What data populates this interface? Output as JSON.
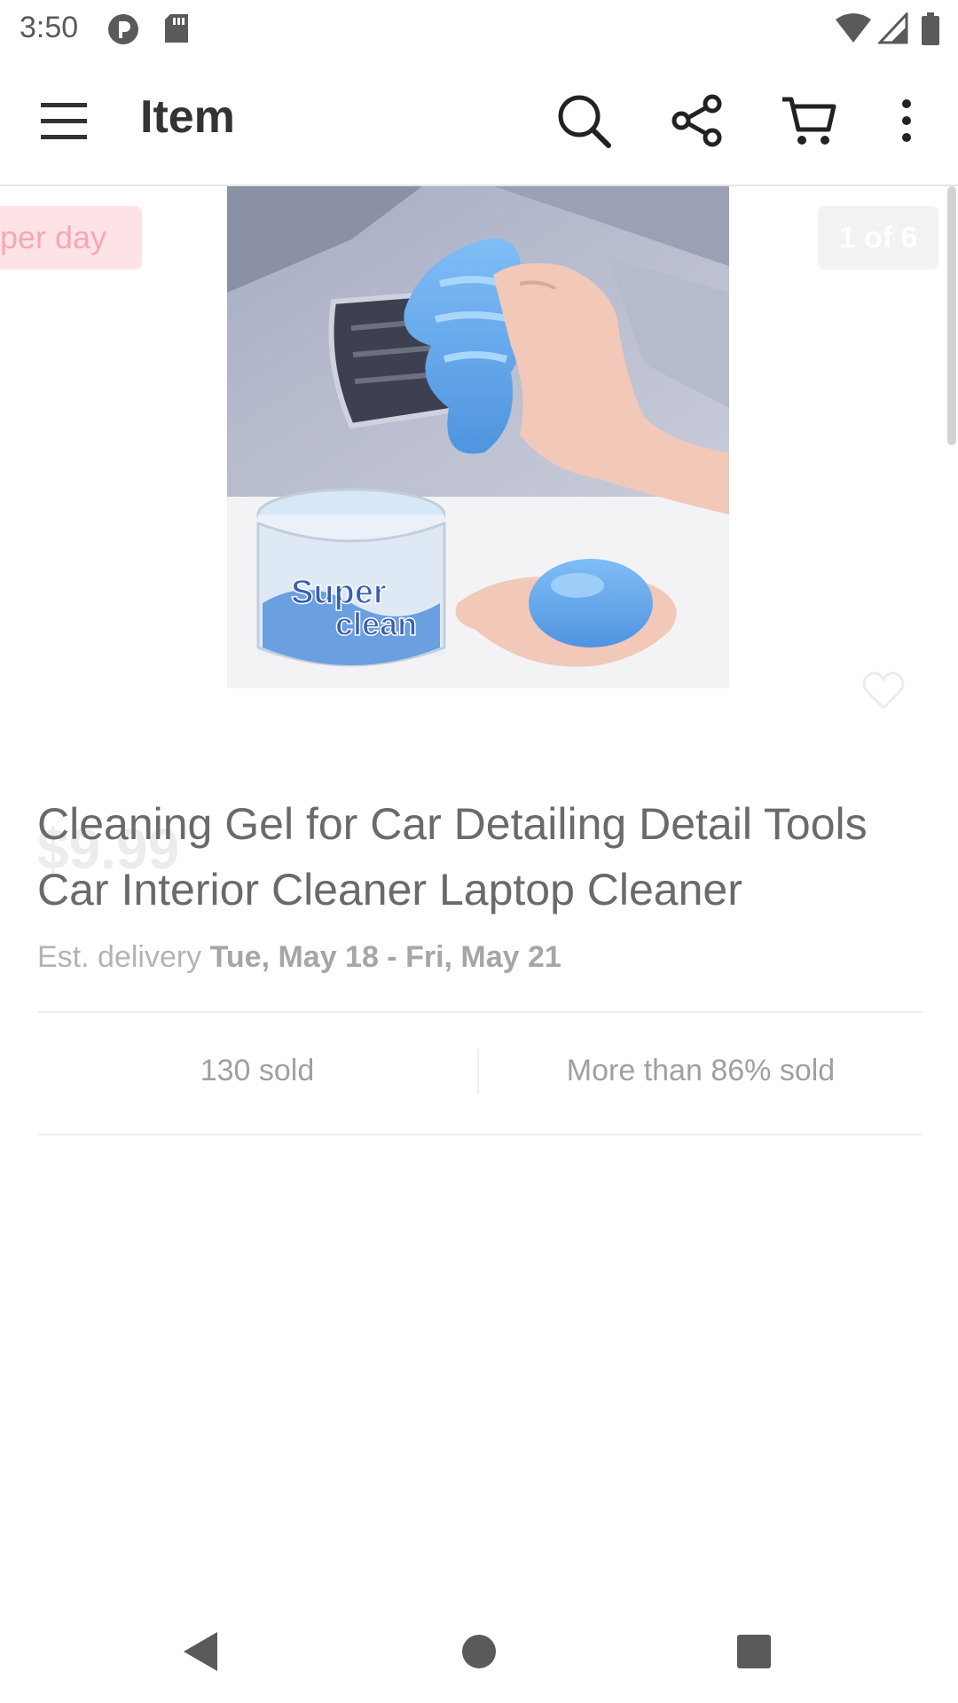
{
  "status_bar": {
    "time": "3:50",
    "icons": [
      "vpn-icon",
      "sd-card-icon",
      "wifi-icon",
      "signal-icon",
      "battery-icon"
    ]
  },
  "app_bar": {
    "title": "Item",
    "icons": [
      "menu-icon",
      "search-icon",
      "share-icon",
      "cart-icon",
      "more-icon"
    ]
  },
  "carousel": {
    "badge_left": "per day",
    "page_indicator": "1 of 6",
    "image_text": "Super clean",
    "favorite_icon": "heart-outline-icon"
  },
  "product": {
    "price": "$9.99",
    "title": "Cleaning Gel for Car Detailing Detail Tools Car Interior Cleaner Laptop Cleaner",
    "delivery_prefix": "Est. delivery",
    "delivery_dates": "Tue, May 18 - Fri, May 21"
  },
  "stats": {
    "sold": "130 sold",
    "sold_percent": "More than 86% sold"
  },
  "nav_bar": {
    "icons": [
      "back-icon",
      "home-icon",
      "recents-icon"
    ]
  },
  "colors": {
    "badge_bg": "#fde3e6",
    "gel_blue": "#6aa8ec",
    "text_muted": "#a0a0a0"
  }
}
